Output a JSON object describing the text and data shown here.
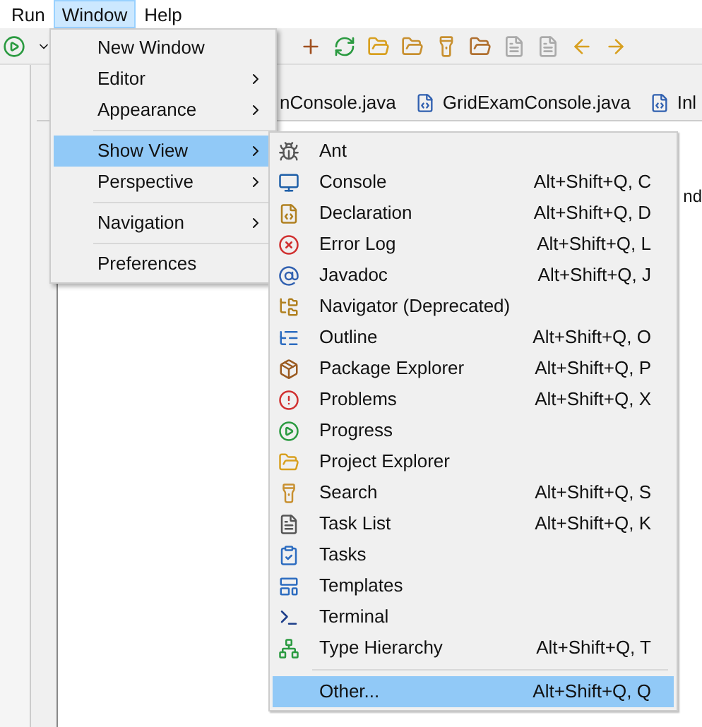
{
  "menu_bar": [
    {
      "label": "Run",
      "selected": false
    },
    {
      "label": "Window",
      "selected": true
    },
    {
      "label": "Help",
      "selected": false
    }
  ],
  "editor_tabs": [
    {
      "label": "nConsole.java"
    },
    {
      "label": "GridExamConsole.java"
    },
    {
      "label": "Inl"
    }
  ],
  "editor_fragment": "nd",
  "window_menu": [
    {
      "kind": "item",
      "label": "New Window",
      "submenu": false,
      "selected": false
    },
    {
      "kind": "item",
      "label": "Editor",
      "submenu": true,
      "selected": false
    },
    {
      "kind": "item",
      "label": "Appearance",
      "submenu": true,
      "selected": false
    },
    {
      "kind": "separator"
    },
    {
      "kind": "item",
      "label": "Show View",
      "submenu": true,
      "selected": true
    },
    {
      "kind": "item",
      "label": "Perspective",
      "submenu": true,
      "selected": false
    },
    {
      "kind": "separator"
    },
    {
      "kind": "item",
      "label": "Navigation",
      "submenu": true,
      "selected": false
    },
    {
      "kind": "separator"
    },
    {
      "kind": "item",
      "label": "Preferences",
      "submenu": false,
      "selected": false
    }
  ],
  "show_view_menu": [
    {
      "kind": "item",
      "label": "Ant",
      "selected": false
    },
    {
      "kind": "item",
      "label": "Console",
      "shortcut": "Alt+Shift+Q, C",
      "selected": false
    },
    {
      "kind": "item",
      "label": "Declaration",
      "shortcut": "Alt+Shift+Q, D",
      "selected": false
    },
    {
      "kind": "item",
      "label": "Error Log",
      "shortcut": "Alt+Shift+Q, L",
      "selected": false
    },
    {
      "kind": "item",
      "label": "Javadoc",
      "shortcut": "Alt+Shift+Q, J",
      "selected": false
    },
    {
      "kind": "item",
      "label": "Navigator (Deprecated)",
      "selected": false
    },
    {
      "kind": "item",
      "label": "Outline",
      "shortcut": "Alt+Shift+Q, O",
      "selected": false
    },
    {
      "kind": "item",
      "label": "Package Explorer",
      "shortcut": "Alt+Shift+Q, P",
      "selected": false
    },
    {
      "kind": "item",
      "label": "Problems",
      "shortcut": "Alt+Shift+Q, X",
      "selected": false
    },
    {
      "kind": "item",
      "label": "Progress",
      "selected": false
    },
    {
      "kind": "item",
      "label": "Project Explorer",
      "selected": false
    },
    {
      "kind": "item",
      "label": "Search",
      "shortcut": "Alt+Shift+Q, S",
      "selected": false
    },
    {
      "kind": "item",
      "label": "Task List",
      "shortcut": "Alt+Shift+Q, K",
      "selected": false
    },
    {
      "kind": "item",
      "label": "Tasks",
      "selected": false
    },
    {
      "kind": "item",
      "label": "Templates",
      "selected": false
    },
    {
      "kind": "item",
      "label": "Terminal",
      "selected": false
    },
    {
      "kind": "item",
      "label": "Type Hierarchy",
      "shortcut": "Alt+Shift+Q, T",
      "selected": false
    },
    {
      "kind": "separator"
    },
    {
      "kind": "item",
      "label": "Other...",
      "shortcut": "Alt+Shift+Q, Q",
      "selected": true
    }
  ]
}
